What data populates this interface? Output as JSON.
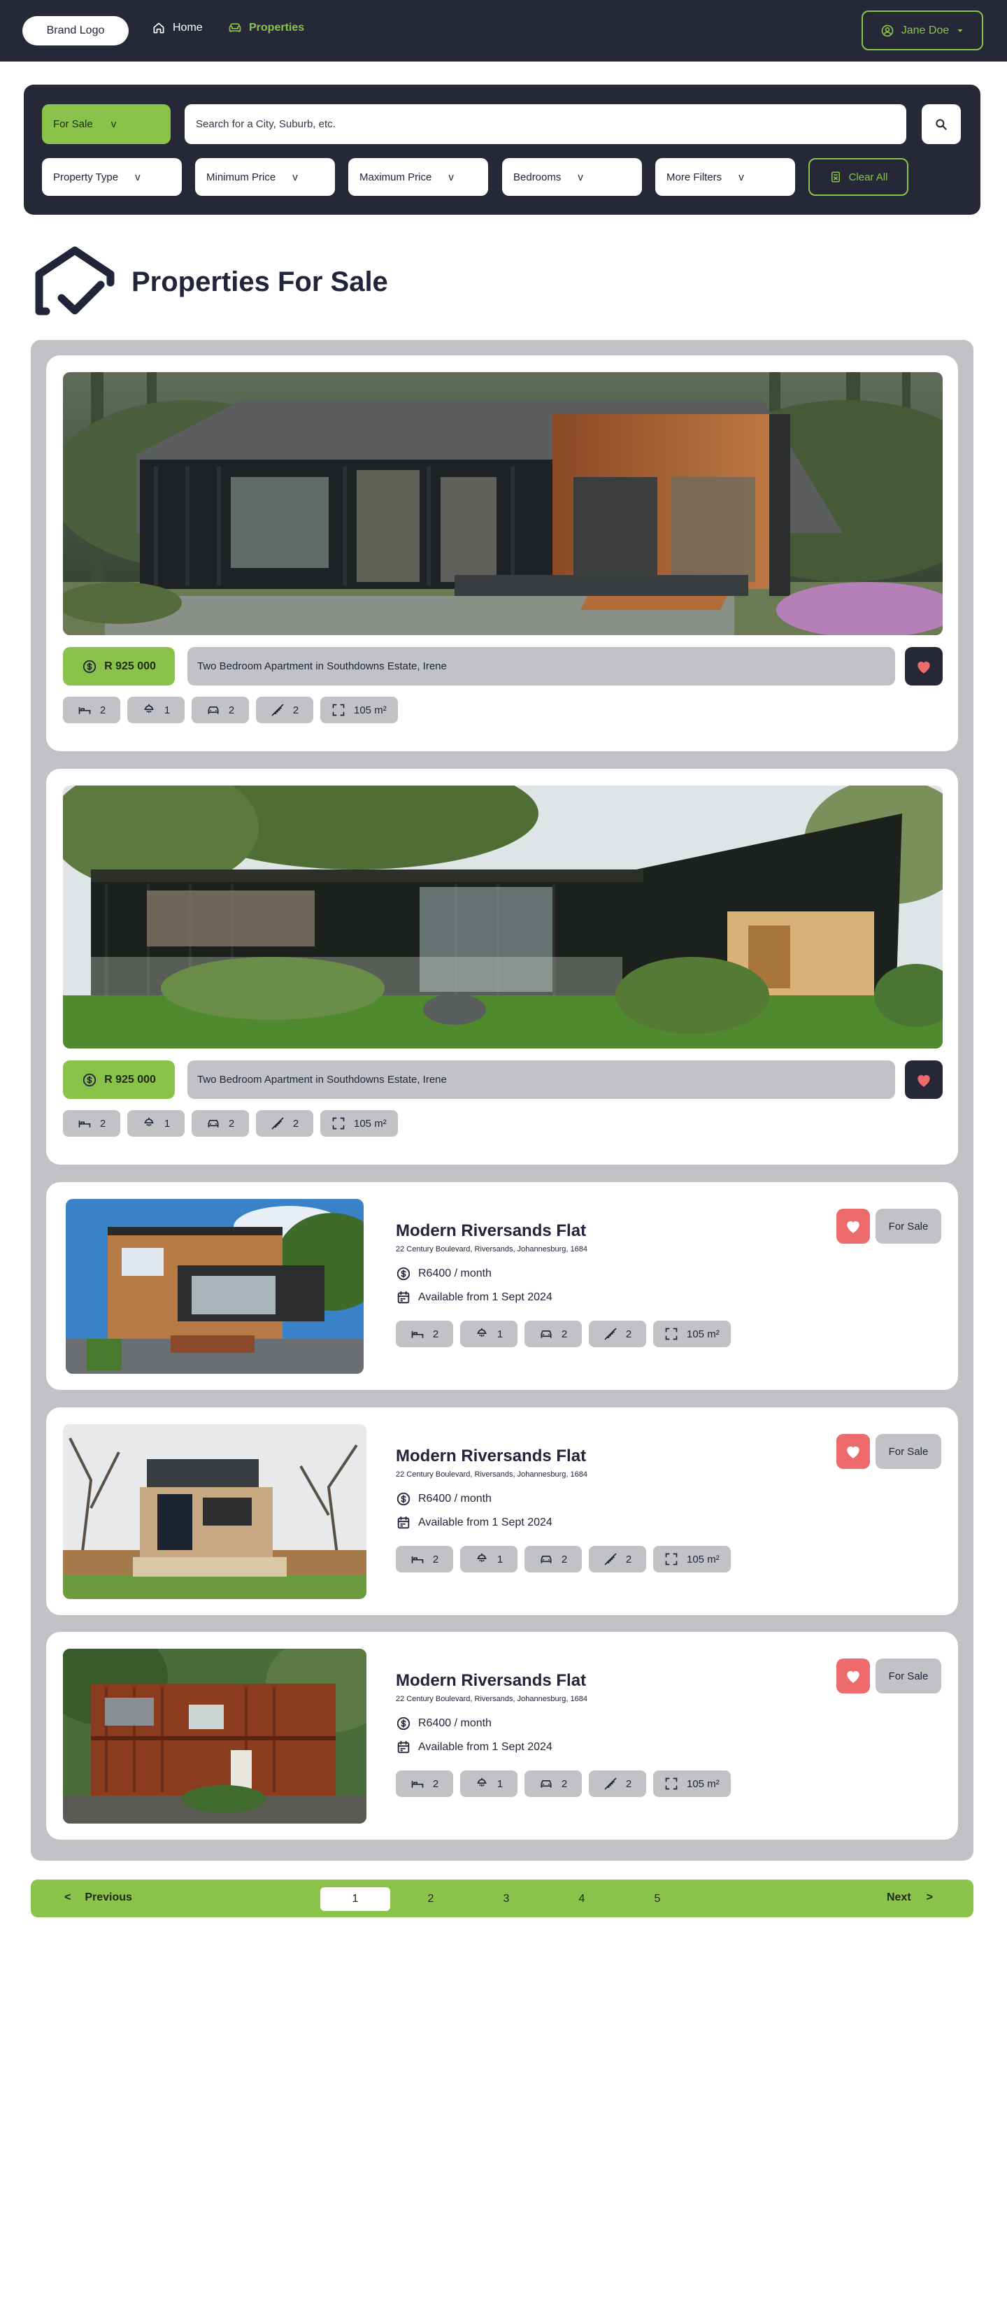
{
  "header": {
    "brand": "Brand Logo",
    "nav": [
      {
        "label": "Home",
        "icon": "home-icon"
      },
      {
        "label": "Properties",
        "icon": "sofa-icon",
        "active": true
      }
    ],
    "user": {
      "name": "Jane Doe",
      "icon": "user-circle-icon"
    }
  },
  "filters": {
    "listing_type": "For Sale",
    "search_placeholder": "Search for a City, Suburb, etc.",
    "selects": [
      "Property Type",
      "Minimum Price",
      "Maximum Price",
      "Bedrooms",
      "More Filters"
    ],
    "chevron": "v",
    "clear_label": "Clear All"
  },
  "page": {
    "title": "Properties For Sale"
  },
  "featured": [
    {
      "price": "R 925 000",
      "title": "Two Bedroom Apartment in Southdowns Estate, Irene",
      "favorite": true,
      "features": {
        "bedrooms": "2",
        "bathrooms": "1",
        "garages": "2",
        "floors": "2",
        "size": "105 m²"
      }
    },
    {
      "price": "R 925 000",
      "title": "Two Bedroom Apartment in Southdowns Estate, Irene",
      "favorite": true,
      "features": {
        "bedrooms": "2",
        "bathrooms": "1",
        "garages": "2",
        "floors": "2",
        "size": "105 m²"
      }
    }
  ],
  "listings": [
    {
      "title": "Modern Riversands Flat",
      "address": "22 Century Boulevard, Riversands, Johannesburg, 1684",
      "rent": "R6400 / month",
      "available": "Available from 1 Sept 2024",
      "status": "For Sale",
      "features": {
        "bedrooms": "2",
        "bathrooms": "1",
        "garages": "2",
        "floors": "2",
        "size": "105 m²"
      }
    },
    {
      "title": "Modern Riversands Flat",
      "address": "22 Century Boulevard, Riversands, Johannesburg, 1684",
      "rent": "R6400 / month",
      "available": "Available from 1 Sept 2024",
      "status": "For Sale",
      "features": {
        "bedrooms": "2",
        "bathrooms": "1",
        "garages": "2",
        "floors": "2",
        "size": "105 m²"
      }
    },
    {
      "title": "Modern Riversands Flat",
      "address": "22 Century Boulevard, Riversands, Johannesburg, 1684",
      "rent": "R6400 / month",
      "available": "Available from 1 Sept 2024",
      "status": "For Sale",
      "features": {
        "bedrooms": "2",
        "bathrooms": "1",
        "garages": "2",
        "floors": "2",
        "size": "105 m²"
      }
    }
  ],
  "pagination": {
    "prev_arrow": "<",
    "prev": "Previous",
    "next": "Next",
    "next_arrow": ">",
    "pages": [
      "1",
      "2",
      "3",
      "4",
      "5"
    ],
    "current_page": "1"
  },
  "colors": {
    "navy": "#262838",
    "accent": "#8bc34a",
    "card_bg": "#c1c2c6",
    "heart": "#ed6b6b"
  }
}
